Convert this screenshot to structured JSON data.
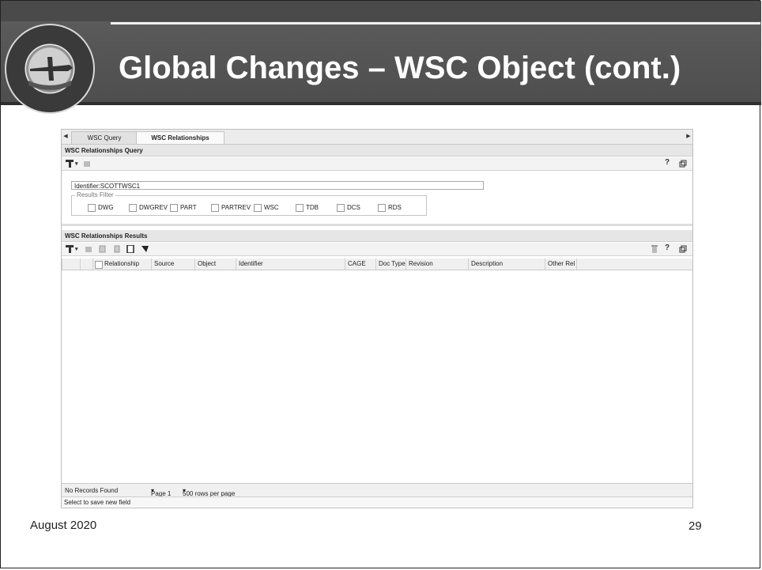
{
  "slide": {
    "title": "Global Changes – WSC Object (cont.)",
    "footer_date": "August 2020",
    "page_number": "29",
    "logo_icon": "seal-logo",
    "logo_text": "JOINT ENGINEERING DATA MANAGEMENT INFORMATION AND CONTROL SYSTEM"
  },
  "app": {
    "tabs": [
      {
        "label": "WSC Query",
        "active": false
      },
      {
        "label": "WSC Relationships",
        "active": true
      }
    ],
    "query_section": {
      "title": "WSC Relationships Query",
      "identifier_value": "Identifier:SCOTTWSC1",
      "filter_legend": "Results Filter",
      "filters": [
        "DWG",
        "DWGREV",
        "PART",
        "PARTREV",
        "WSC",
        "TDB",
        "DCS",
        "RDS"
      ]
    },
    "results_section": {
      "title": "WSC Relationships Results",
      "columns": [
        "Relationship",
        "Source",
        "Object",
        "Identifier",
        "CAGE",
        "Doc Type",
        "Revision",
        "Description",
        "Other Rel"
      ]
    },
    "pager": {
      "records": "No Records Found",
      "page": "Page 1",
      "rows_per_page": "500 rows per page"
    },
    "status": "Select to save new field",
    "toolbar_help": "?"
  },
  "colors": {
    "header_bg": "#555555",
    "title_text": "#ffffff",
    "accent_line": "#f2f2f2"
  }
}
